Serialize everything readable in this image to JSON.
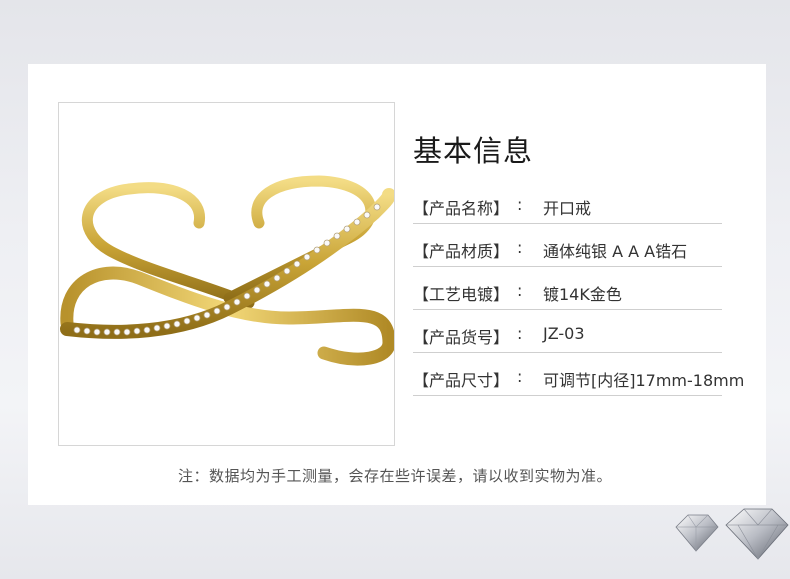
{
  "title": "基本信息",
  "rows": [
    {
      "label": "【产品名称】",
      "sep": ":",
      "value": "开口戒"
    },
    {
      "label": "【产品材质】",
      "sep": ":",
      "value": "通体纯银 A A A锆石"
    },
    {
      "label": "【工艺电镀】",
      "sep": ":",
      "value": "镀14K金色"
    },
    {
      "label": "【产品货号】",
      "sep": ":",
      "value": "JZ-03"
    },
    {
      "label": "【产品尺寸】",
      "sep": ":",
      "value": "可调节[内径]17mm-18mm"
    }
  ],
  "note": "注：数据均为手工测量，会存在些许误差，请以收到实物为准。",
  "colors": {
    "gold": "#c9a436",
    "gold_dark": "#9c7a1c",
    "gold_light": "#f0d67a",
    "divider": "#cfcfcf"
  },
  "icons": {
    "photo": "gold-ring-photo",
    "decor": "diamond-icon"
  }
}
